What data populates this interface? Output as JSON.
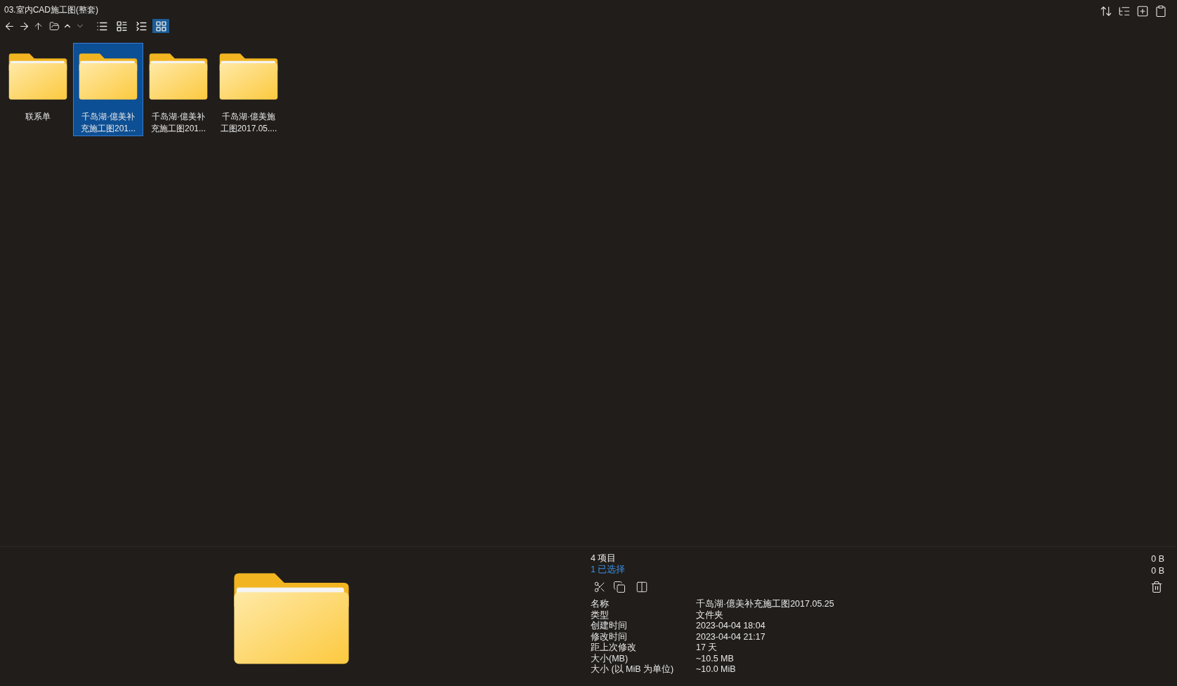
{
  "window": {
    "title": "03.室内CAD施工图(整套)"
  },
  "view_modes": [
    {
      "kind": "list",
      "selected": false
    },
    {
      "kind": "tiles",
      "selected": false
    },
    {
      "kind": "details",
      "selected": false
    },
    {
      "kind": "grid",
      "selected": true
    }
  ],
  "items": [
    {
      "name": "联系单",
      "selected": false
    },
    {
      "name": "千岛湖·億美补充施工图201...",
      "selected": true
    },
    {
      "name": "千岛湖·億美补充施工图201...",
      "selected": false
    },
    {
      "name": "千岛湖·億美施工图2017.05....",
      "selected": false
    }
  ],
  "summary": {
    "item_count": "4 项目",
    "selected_count": "1 已选择"
  },
  "properties": [
    {
      "label": "名称",
      "value": "千岛湖·億美补充施工图2017.05.25"
    },
    {
      "label": "类型",
      "value": "文件夹"
    },
    {
      "label": "创建时间",
      "value": "2023-04-04  18:04"
    },
    {
      "label": "修改时间",
      "value": "2023-04-04  21:17"
    },
    {
      "label": "距上次修改",
      "value": "17 天"
    },
    {
      "label": "大小(MB)",
      "value": "~10.5 MB"
    },
    {
      "label": "大小 (以 MiB 为单位)",
      "value": "~10.0 MiB"
    }
  ],
  "sizes": [
    "0 B",
    "0 B"
  ]
}
